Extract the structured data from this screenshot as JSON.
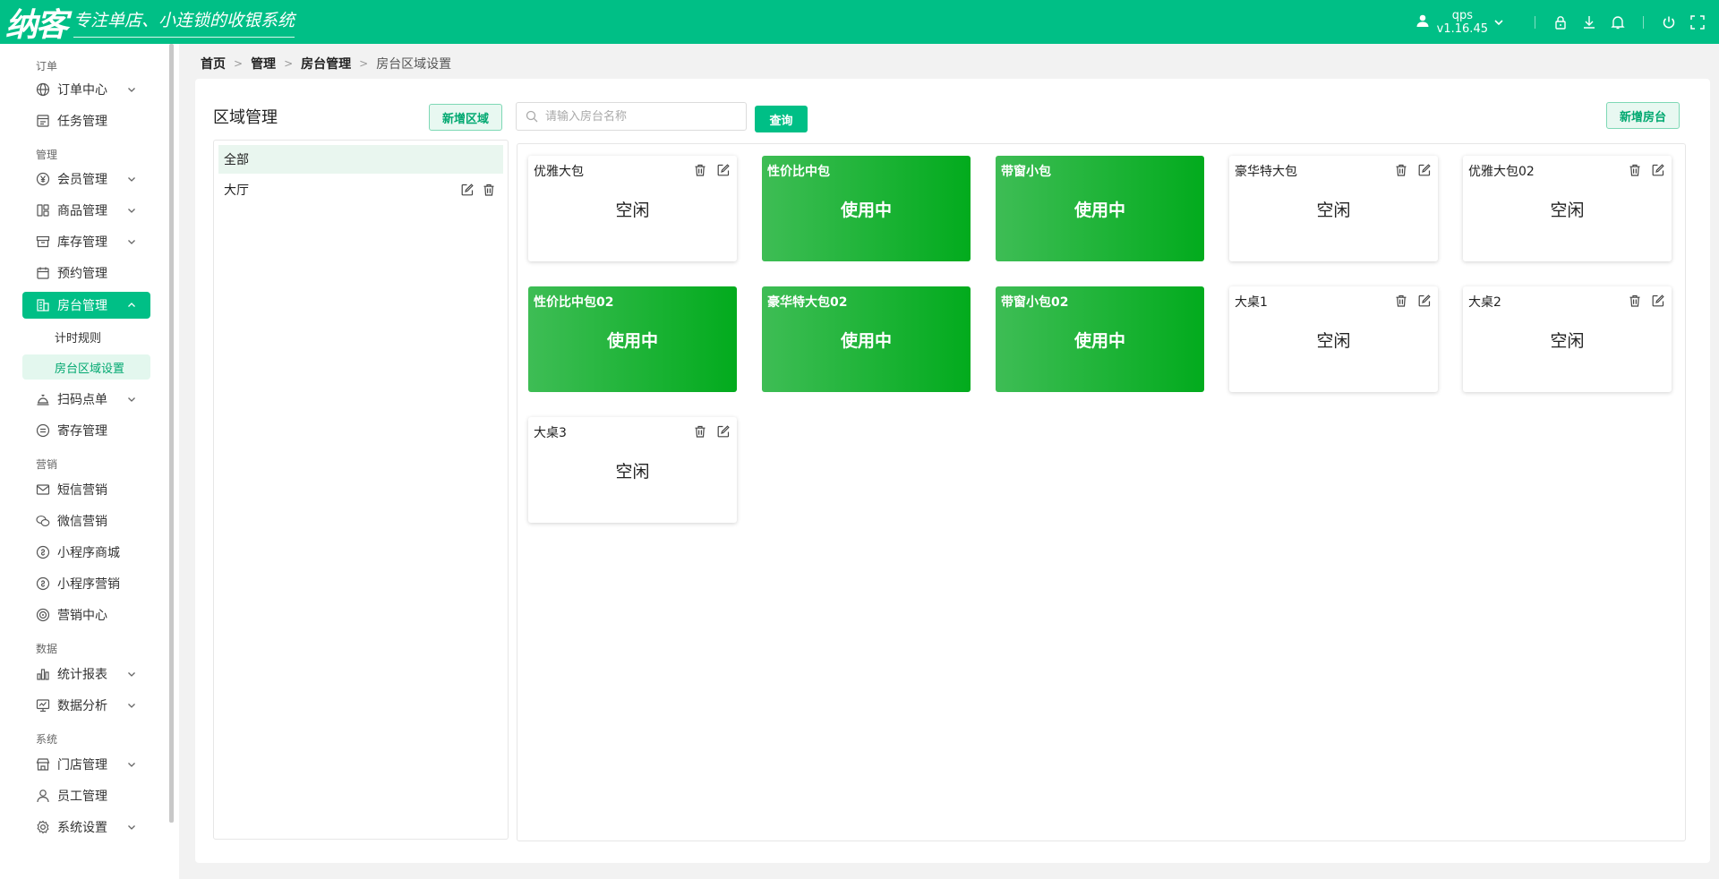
{
  "app": {
    "logo_text": "纳客",
    "slogan": "专注单店、小连锁的收银系统",
    "user": "qps",
    "version": "v1.16.45"
  },
  "sidebar": {
    "groups": [
      "订单",
      "管理",
      "营销",
      "数据",
      "系统"
    ],
    "items": [
      {
        "label": "订单中心",
        "icon": "globe-icon"
      },
      {
        "label": "任务管理",
        "icon": "task-icon"
      },
      {
        "label": "会员管理",
        "icon": "yen-icon"
      },
      {
        "label": "商品管理",
        "icon": "grid-icon"
      },
      {
        "label": "库存管理",
        "icon": "box-icon"
      },
      {
        "label": "预约管理",
        "icon": "calendar-icon"
      },
      {
        "label": "房台管理",
        "icon": "building-icon"
      },
      {
        "label": "扫码点单",
        "icon": "bell-service-icon"
      },
      {
        "label": "寄存管理",
        "icon": "storage-icon"
      },
      {
        "label": "短信营销",
        "icon": "mail-icon"
      },
      {
        "label": "微信营销",
        "icon": "wechat-icon"
      },
      {
        "label": "小程序商城",
        "icon": "miniapp-icon"
      },
      {
        "label": "小程序营销",
        "icon": "miniapp-icon"
      },
      {
        "label": "营销中心",
        "icon": "target-icon"
      },
      {
        "label": "统计报表",
        "icon": "chart-bar-icon"
      },
      {
        "label": "数据分析",
        "icon": "analysis-icon"
      },
      {
        "label": "门店管理",
        "icon": "store-icon"
      },
      {
        "label": "员工管理",
        "icon": "user-icon"
      },
      {
        "label": "系统设置",
        "icon": "gear-icon"
      }
    ],
    "sub_items": [
      "计时规则",
      "房台区域设置"
    ]
  },
  "breadcrumb": [
    "首页",
    "管理",
    "房台管理",
    "房台区域设置"
  ],
  "area_panel": {
    "title": "区域管理",
    "add_button": "新增区域",
    "areas": [
      "全部",
      "大厅"
    ]
  },
  "search": {
    "placeholder": "请输入房台名称",
    "value": "",
    "button": "查询"
  },
  "add_room_button": "新增房台",
  "rooms": [
    {
      "name": "优雅大包",
      "status": "空闲"
    },
    {
      "name": "性价比中包",
      "status": "使用中"
    },
    {
      "name": "带窗小包",
      "status": "使用中"
    },
    {
      "name": "豪华特大包",
      "status": "空闲"
    },
    {
      "name": "优雅大包02",
      "status": "空闲"
    },
    {
      "name": "性价比中包02",
      "status": "使用中"
    },
    {
      "name": "豪华特大包02",
      "status": "使用中"
    },
    {
      "name": "带窗小包02",
      "status": "使用中"
    },
    {
      "name": "大桌1",
      "status": "空闲"
    },
    {
      "name": "大桌2",
      "status": "空闲"
    },
    {
      "name": "大桌3",
      "status": "空闲"
    }
  ],
  "colors": {
    "brand": "#00bf86",
    "busy_start": "#3ebd55",
    "busy_end": "#02ab1d"
  }
}
